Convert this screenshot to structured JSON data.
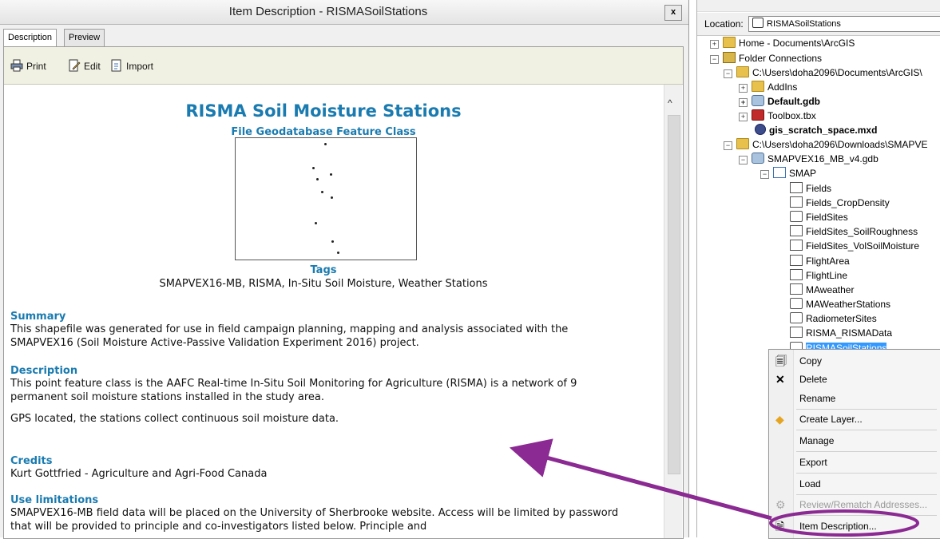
{
  "window": {
    "title": "Item Description - RISMASoilStations",
    "close_label": "x",
    "tabs": [
      "Description",
      "Preview"
    ]
  },
  "toolbar": {
    "print_label": "Print",
    "edit_label": "Edit",
    "import_label": "Import"
  },
  "document": {
    "title": "RISMA Soil Moisture Stations",
    "subtitle": "File Geodatabase Feature Class",
    "tags_heading": "Tags",
    "tags_value": "SMAPVEX16-MB, RISMA, In-Situ Soil Moisture, Weather Stations",
    "summary_heading": "Summary",
    "summary_text": "This shapefile was generated for use in field campaign planning, mapping and analysis associated with the SMAPVEX16 (Soil Moisture Active-Passive Validation Experiment 2016) project.",
    "description_heading": "Description",
    "description_text_1": "This point feature class is the AAFC Real-time In-Situ Soil Monitoring for Agriculture (RISMA) is a network of 9 permanent soil moisture stations installed in the study area.",
    "description_text_2": "GPS located, the stations collect continuous soil moisture data.",
    "credits_heading": "Credits",
    "credits_text": "Kurt Gottfried - Agriculture and Agri-Food Canada",
    "use_limitations_heading": "Use limitations",
    "use_limitations_text": "SMAPVEX16-MB field data will be placed on the University of Sherbrooke website. Access will be limited by password that will be provided to principle and co-investigators listed below. Principle and"
  },
  "location": {
    "label": "Location:",
    "value": "RISMASoilStations"
  },
  "tree": [
    {
      "label": "Home - Documents\\ArcGIS",
      "icon": "folder-home-icon",
      "expander": "+",
      "bold": false
    },
    {
      "label": "Folder Connections",
      "icon": "folder-connections-icon",
      "expander": "−",
      "bold": false
    },
    {
      "label": "C:\\Users\\doha2096\\Documents\\ArcGIS\\",
      "icon": "folder-icon",
      "expander": "−",
      "bold": false
    },
    {
      "label": "AddIns",
      "icon": "folder-icon",
      "expander": "+",
      "bold": false
    },
    {
      "label": "Default.gdb",
      "icon": "geodatabase-icon",
      "expander": "+",
      "bold": true
    },
    {
      "label": "Toolbox.tbx",
      "icon": "toolbox-icon",
      "expander": "+",
      "bold": false
    },
    {
      "label": "gis_scratch_space.mxd",
      "icon": "map-document-icon",
      "expander": "",
      "bold": true
    },
    {
      "label": "C:\\Users\\doha2096\\Downloads\\SMAPVE",
      "icon": "folder-icon",
      "expander": "−",
      "bold": false
    },
    {
      "label": "SMAPVEX16_MB_v4.gdb",
      "icon": "geodatabase-icon",
      "expander": "−",
      "bold": false
    },
    {
      "label": "SMAP",
      "icon": "feature-dataset-icon",
      "expander": "−",
      "bold": false
    },
    {
      "label": "Fields",
      "icon": "polygon-feature-class-icon",
      "expander": "",
      "bold": false
    },
    {
      "label": "Fields_CropDensity",
      "icon": "relationship-class-icon",
      "expander": "",
      "bold": false
    },
    {
      "label": "FieldSites",
      "icon": "point-feature-class-icon",
      "expander": "",
      "bold": false
    },
    {
      "label": "FieldSites_SoilRoughness",
      "icon": "relationship-class-icon",
      "expander": "",
      "bold": false
    },
    {
      "label": "FieldSites_VolSoilMoisture",
      "icon": "relationship-class-icon",
      "expander": "",
      "bold": false
    },
    {
      "label": "FlightArea",
      "icon": "polygon-feature-class-icon",
      "expander": "",
      "bold": false
    },
    {
      "label": "FlightLine",
      "icon": "line-feature-class-icon",
      "expander": "",
      "bold": false
    },
    {
      "label": "MAweather",
      "icon": "relationship-class-icon",
      "expander": "",
      "bold": false
    },
    {
      "label": "MAWeatherStations",
      "icon": "point-feature-class-icon",
      "expander": "",
      "bold": false
    },
    {
      "label": "RadiometerSites",
      "icon": "point-feature-class-icon",
      "expander": "",
      "bold": false
    },
    {
      "label": "RISMA_RISMAData",
      "icon": "relationship-class-icon",
      "expander": "",
      "bold": false
    },
    {
      "label": "RISMASoilStations",
      "icon": "point-feature-class-icon",
      "expander": "",
      "bold": false,
      "selected": true
    }
  ],
  "context_menu": [
    {
      "label": "Copy",
      "icon": "copy-icon",
      "glyph": "🗐",
      "disabled": false
    },
    {
      "label": "Delete",
      "icon": "delete-icon",
      "glyph": "✕",
      "disabled": false
    },
    {
      "label": "Rename",
      "icon": "",
      "glyph": "",
      "disabled": false
    },
    {
      "label": "Create Layer...",
      "icon": "create-layer-icon",
      "glyph": "◆",
      "disabled": false
    },
    {
      "label": "Manage",
      "icon": "",
      "glyph": "",
      "disabled": false
    },
    {
      "label": "Export",
      "icon": "",
      "glyph": "",
      "disabled": false
    },
    {
      "label": "Load",
      "icon": "",
      "glyph": "",
      "disabled": false
    },
    {
      "label": "Review/Rematch Addresses...",
      "icon": "review-icon",
      "glyph": "⚙",
      "disabled": true
    },
    {
      "label": "Item Description...",
      "icon": "item-description-icon",
      "glyph": "🗎",
      "disabled": false
    }
  ],
  "colors": {
    "heading_blue": "#1a7bb0",
    "annotation_purple": "#8b2a92",
    "selection_blue": "#3399ff"
  }
}
